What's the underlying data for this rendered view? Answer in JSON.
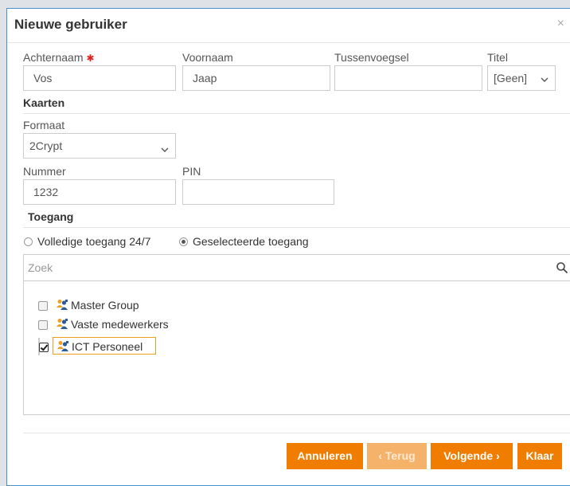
{
  "dialog": {
    "title": "Nieuwe gebruiker",
    "close": "×"
  },
  "fields": {
    "achternaam": {
      "label": "Achternaam",
      "required": "✱",
      "value": "Vos"
    },
    "voornaam": {
      "label": "Voornaam",
      "value": "Jaap"
    },
    "tussenvoegsel": {
      "label": "Tussenvoegsel",
      "value": ""
    },
    "titel": {
      "label": "Titel",
      "value": "[Geen]"
    }
  },
  "kaarten": {
    "heading": "Kaarten",
    "formaat": {
      "label": "Formaat",
      "value": "2Crypt"
    },
    "nummer": {
      "label": "Nummer",
      "value": "1232"
    },
    "pin": {
      "label": "PIN",
      "value": ""
    }
  },
  "toegang": {
    "heading": "Toegang",
    "options": [
      {
        "label": "Volledige toegang 24/7",
        "selected": false
      },
      {
        "label": "Geselecteerde toegang",
        "selected": true
      }
    ],
    "search_placeholder": "Zoek",
    "groups": [
      {
        "label": "Master Group",
        "checked": false
      },
      {
        "label": "Vaste medewerkers",
        "checked": false
      },
      {
        "label": "ICT Personeel",
        "checked": true
      }
    ]
  },
  "buttons": {
    "annuleren": "Annuleren",
    "terug": "Terug",
    "terug_icon": "‹",
    "volgende": "Volgende",
    "volgende_icon": "›",
    "klaar": "Klaar"
  },
  "colors": {
    "accent": "#f07c00",
    "accent_disabled": "#f5b26b",
    "border": "#4a90c8"
  }
}
